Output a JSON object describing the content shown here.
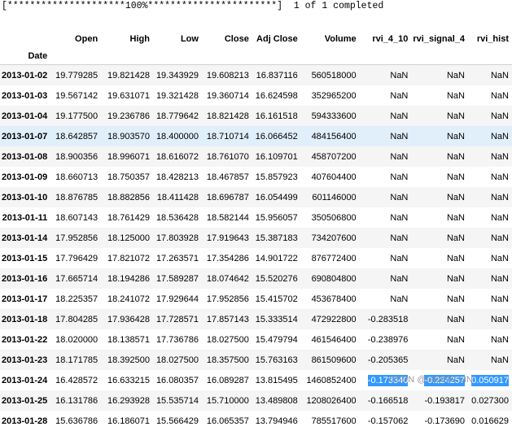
{
  "progress": {
    "text": "[*********************100%***********************]  1 of 1 completed",
    "percent": 100
  },
  "table": {
    "columns": [
      "Open",
      "High",
      "Low",
      "Close",
      "Adj Close",
      "Volume",
      "rvi_4_10",
      "rvi_signal_4",
      "rvi_hist"
    ],
    "index_name": "Date",
    "rows": [
      {
        "date": "2013-01-02",
        "cells": [
          "19.779285",
          "19.821428",
          "19.343929",
          "19.608213",
          "16.837116",
          "560518000",
          "NaN",
          "NaN",
          "NaN"
        ]
      },
      {
        "date": "2013-01-03",
        "cells": [
          "19.567142",
          "19.631071",
          "19.321428",
          "19.360714",
          "16.624598",
          "352965200",
          "NaN",
          "NaN",
          "NaN"
        ]
      },
      {
        "date": "2013-01-04",
        "cells": [
          "19.177500",
          "19.236786",
          "18.779642",
          "18.821428",
          "16.161518",
          "594333600",
          "NaN",
          "NaN",
          "NaN"
        ]
      },
      {
        "date": "2013-01-07",
        "cells": [
          "18.642857",
          "18.903570",
          "18.400000",
          "18.710714",
          "16.066452",
          "484156400",
          "NaN",
          "NaN",
          "NaN"
        ]
      },
      {
        "date": "2013-01-08",
        "cells": [
          "18.900356",
          "18.996071",
          "18.616072",
          "18.761070",
          "16.109701",
          "458707200",
          "NaN",
          "NaN",
          "NaN"
        ]
      },
      {
        "date": "2013-01-09",
        "cells": [
          "18.660713",
          "18.750357",
          "18.428213",
          "18.467857",
          "15.857923",
          "407604400",
          "NaN",
          "NaN",
          "NaN"
        ]
      },
      {
        "date": "2013-01-10",
        "cells": [
          "18.876785",
          "18.882856",
          "18.411428",
          "18.696787",
          "16.054499",
          "601146000",
          "NaN",
          "NaN",
          "NaN"
        ]
      },
      {
        "date": "2013-01-11",
        "cells": [
          "18.607143",
          "18.761429",
          "18.536428",
          "18.582144",
          "15.956057",
          "350506800",
          "NaN",
          "NaN",
          "NaN"
        ]
      },
      {
        "date": "2013-01-14",
        "cells": [
          "17.952856",
          "18.125000",
          "17.803928",
          "17.919643",
          "15.387183",
          "734207600",
          "NaN",
          "NaN",
          "NaN"
        ]
      },
      {
        "date": "2013-01-15",
        "cells": [
          "17.796429",
          "17.821072",
          "17.263571",
          "17.354286",
          "14.901722",
          "876772400",
          "NaN",
          "NaN",
          "NaN"
        ]
      },
      {
        "date": "2013-01-16",
        "cells": [
          "17.665714",
          "18.194286",
          "17.589287",
          "18.074642",
          "15.520276",
          "690804800",
          "NaN",
          "NaN",
          "NaN"
        ]
      },
      {
        "date": "2013-01-17",
        "cells": [
          "18.225357",
          "18.241072",
          "17.929644",
          "17.952856",
          "15.415702",
          "453678400",
          "NaN",
          "NaN",
          "NaN"
        ]
      },
      {
        "date": "2013-01-18",
        "cells": [
          "17.804285",
          "17.936428",
          "17.728571",
          "17.857143",
          "15.333514",
          "472922800",
          "-0.283518",
          "NaN",
          "NaN"
        ]
      },
      {
        "date": "2013-01-22",
        "cells": [
          "18.020000",
          "18.138571",
          "17.736786",
          "18.027500",
          "15.479794",
          "461546400",
          "-0.238976",
          "NaN",
          "NaN"
        ]
      },
      {
        "date": "2013-01-23",
        "cells": [
          "18.171785",
          "18.392500",
          "18.027500",
          "18.357500",
          "15.763163",
          "861509600",
          "-0.205365",
          "NaN",
          "NaN"
        ]
      },
      {
        "date": "2013-01-24",
        "cells": [
          "16.428572",
          "16.633215",
          "16.080357",
          "16.089287",
          "13.815495",
          "1460852400",
          "-0.173340",
          "-0.224257",
          "0.050917"
        ]
      },
      {
        "date": "2013-01-25",
        "cells": [
          "16.131786",
          "16.293928",
          "15.535714",
          "15.710000",
          "13.489808",
          "1208026400",
          "-0.166518",
          "-0.193817",
          "0.027300"
        ]
      },
      {
        "date": "2013-01-28",
        "cells": [
          "15.636786",
          "16.186071",
          "15.566429",
          "16.065357",
          "13.794946",
          "785517600",
          "-0.157062",
          "-0.173690",
          "0.016629"
        ]
      }
    ]
  },
  "watermark": "CSDN @LIQING LIN",
  "colors": {
    "selection": "#3399ff",
    "row_hover": "#e1effb",
    "row_stripe": "#f5f5f5"
  }
}
